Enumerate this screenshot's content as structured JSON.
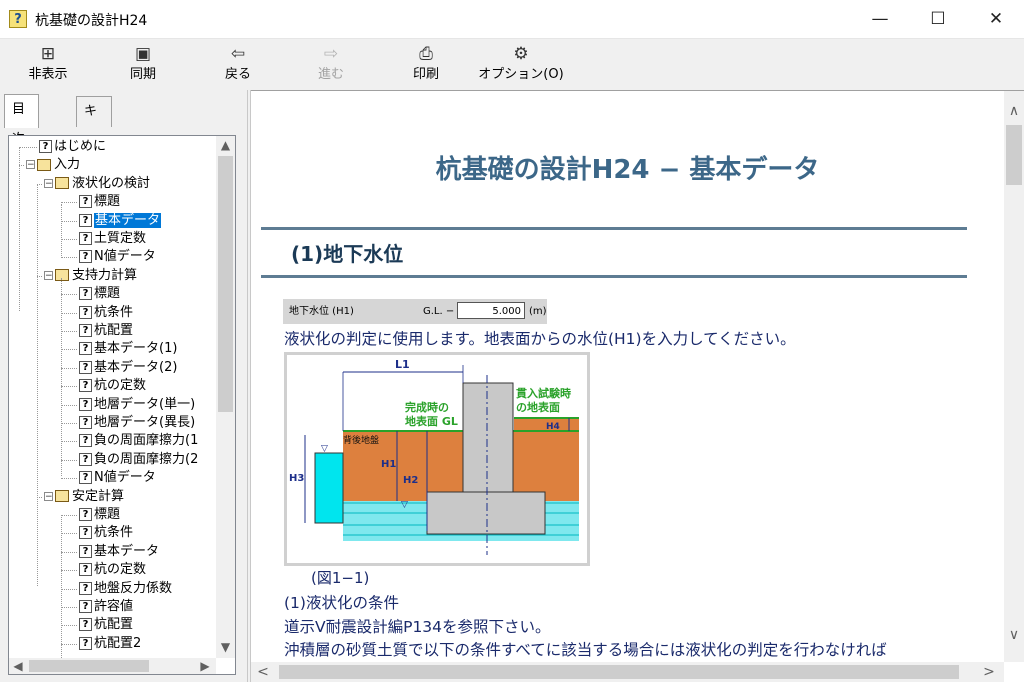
{
  "window": {
    "title": "杭基礎の設計H24",
    "min": "—",
    "max": "☐",
    "close": "✕"
  },
  "toolbar": [
    {
      "icon": "⊞",
      "label": "非表示"
    },
    {
      "icon": "▣",
      "label": "同期"
    },
    {
      "icon": "⇦",
      "label": "戻る"
    },
    {
      "icon": "⇨",
      "label": "進む"
    },
    {
      "icon": "⎙",
      "label": "印刷"
    },
    {
      "icon": "⚙",
      "label": "オプション(O)"
    }
  ],
  "tabs": [
    "目次(C)",
    "キーワード(N)"
  ],
  "tree": [
    {
      "label": "はじめに",
      "type": "topic"
    },
    {
      "label": "入力",
      "type": "book"
    },
    {
      "label": "液状化の検討",
      "type": "book"
    },
    {
      "label": "標題",
      "type": "topic"
    },
    {
      "label": "基本データ",
      "type": "topic",
      "selected": true
    },
    {
      "label": "土質定数",
      "type": "topic"
    },
    {
      "label": "N値データ",
      "type": "topic"
    },
    {
      "label": "支持力計算",
      "type": "book"
    },
    {
      "label": "標題",
      "type": "topic"
    },
    {
      "label": "杭条件",
      "type": "topic"
    },
    {
      "label": "杭配置",
      "type": "topic"
    },
    {
      "label": "基本データ(1)",
      "type": "topic"
    },
    {
      "label": "基本データ(2)",
      "type": "topic"
    },
    {
      "label": "杭の定数",
      "type": "topic"
    },
    {
      "label": "地層データ(単一)",
      "type": "topic"
    },
    {
      "label": "地層データ(異長)",
      "type": "topic"
    },
    {
      "label": "負の周面摩擦力(1",
      "type": "topic"
    },
    {
      "label": "負の周面摩擦力(2",
      "type": "topic"
    },
    {
      "label": "N値データ",
      "type": "topic"
    },
    {
      "label": "安定計算",
      "type": "book"
    },
    {
      "label": "標題",
      "type": "topic"
    },
    {
      "label": "杭条件",
      "type": "topic"
    },
    {
      "label": "基本データ",
      "type": "topic"
    },
    {
      "label": "杭の定数",
      "type": "topic"
    },
    {
      "label": "地盤反力係数",
      "type": "topic"
    },
    {
      "label": "許容値",
      "type": "topic"
    },
    {
      "label": "杭配置",
      "type": "topic"
    },
    {
      "label": "杭配置2",
      "type": "topic"
    }
  ],
  "content": {
    "title": "杭基礎の設計H24 − 基本データ",
    "section": "(1)地下水位",
    "param": {
      "label": "地下水位 (H1)",
      "gl": "G.L. −",
      "value": "5.000",
      "unit": "(m)"
    },
    "line1": "液状化の判定に使用します。地表面からの水位(H1)を入力してください。",
    "figure_labels": {
      "l1": "L1",
      "finish": "完成時の",
      "finish2": "地表面 GL",
      "penetration": "貫入試験時",
      "penetration2": "の地表面",
      "backfill": "背後地盤",
      "h1": "H1",
      "h2": "H2",
      "h3": "H3",
      "h4": "H4"
    },
    "caption": "(図1−1)",
    "line2": "(1)液状化の条件",
    "line3": "道示Ⅴ耐震設計編P134を参照下さい。",
    "line4": "沖積層の砂質土質で以下の条件すべてに該当する場合には液状化の判定を行わなければ"
  },
  "colors": {
    "title": "#3c6788",
    "soil": "#dd803e",
    "water": "#00e5ee",
    "concrete": "#c8c8c8",
    "green": "#2aa22a"
  }
}
